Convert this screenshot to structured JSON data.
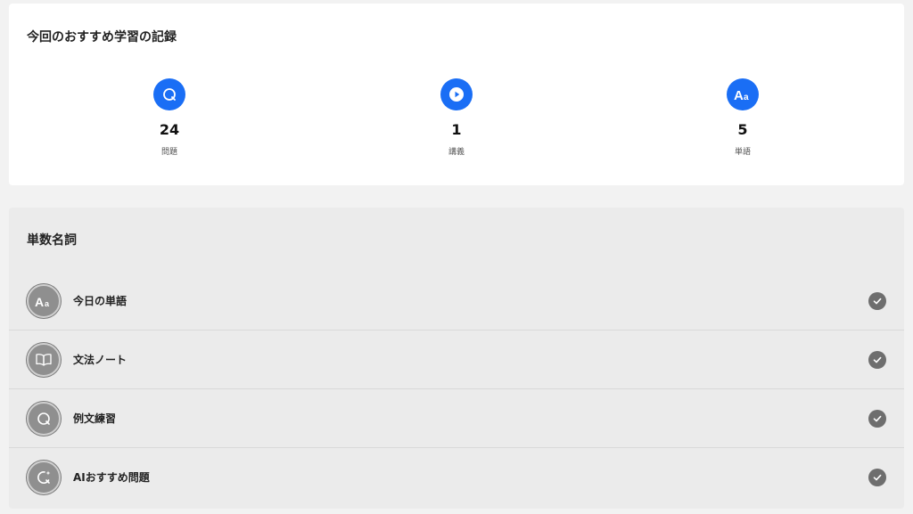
{
  "summary": {
    "title": "今回のおすすめ学習の記録",
    "stats": [
      {
        "icon": "question-icon",
        "value": "24",
        "label": "問題"
      },
      {
        "icon": "play-icon",
        "value": "1",
        "label": "講義"
      },
      {
        "icon": "vocabulary-icon",
        "value": "5",
        "label": "単語"
      }
    ]
  },
  "section": {
    "title": "単数名詞",
    "items": [
      {
        "icon": "vocabulary-icon",
        "label": "今日の単語",
        "completed": true
      },
      {
        "icon": "book-icon",
        "label": "文法ノート",
        "completed": true
      },
      {
        "icon": "question-icon",
        "label": "例文練習",
        "completed": true
      },
      {
        "icon": "ai-question-icon",
        "label": "AIおすすめ問題",
        "completed": true
      }
    ]
  },
  "colors": {
    "accent": "#1a6ef5",
    "completed": "#6e6e6e"
  }
}
